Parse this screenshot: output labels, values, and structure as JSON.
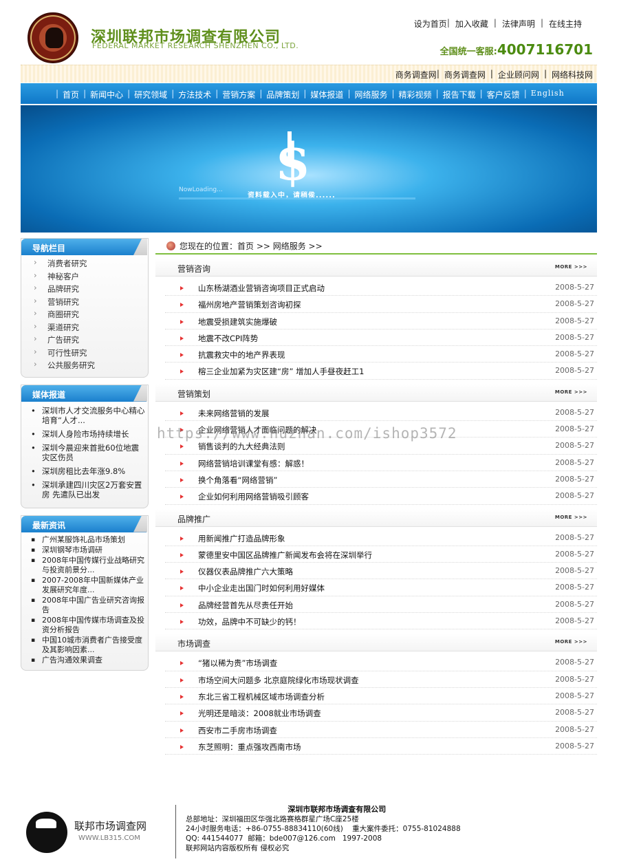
{
  "header": {
    "company_cn": "深圳联邦市场调查有限公司",
    "company_en": "FEDERAL MARKET RESEARCH SHENZHEN CO., LTD.",
    "top_links": [
      "设为首页",
      "加入收藏",
      "法律声明",
      "在线主持"
    ],
    "hotline_label": "全国统一客服:",
    "hotline_number": "4007116701",
    "sub_links": [
      "商务调查网",
      "商务调查网",
      "企业顾问网",
      "网络科技网"
    ]
  },
  "nav": {
    "items": [
      "首页",
      "新闻中心",
      "研究领域",
      "方法技术",
      "营销方案",
      "品牌策划",
      "媒体报道",
      "网络服务",
      "精彩视频",
      "报告下载",
      "客户反馈",
      "English"
    ]
  },
  "banner": {
    "loading_text": "资料载入中，请稍侯......",
    "now_loading": "NowLoading..."
  },
  "sidebar": {
    "nav_title": "导航栏目",
    "nav_items": [
      "消费者研究",
      "神秘客户",
      "品牌研究",
      "营销研究",
      "商圈研究",
      "渠道研究",
      "广告研究",
      "可行性研究",
      "公共服务研究"
    ],
    "media_title": "媒体报道",
    "media_items": [
      "深圳市人才交流服务中心精心培育“人才...",
      "深圳人身险市场持续增长",
      "深圳今晨迎来首批60位地震灾区伤员",
      "深圳房租比去年涨9.8%",
      "深圳承建四川灾区2万套安置房 先遣队已出发"
    ],
    "news_title": "最新资讯",
    "news_items": [
      "广州某服饰礼品市场策划",
      "深圳钢琴市场调研",
      "2008年中国传媒行业战略研究与投资前景分...",
      "2007-2008年中国新媒体产业发展研究年度...",
      "2008年中国广告业研究咨询报告",
      "2008年中国传媒市场调查及投资分析报告",
      "中国10城市消费者广告接受度及其影响因素...",
      "广告沟通效果调查"
    ]
  },
  "main": {
    "breadcrumb": "您现在的位置：首页 >> 网络服务 >>",
    "more_label": "MORE >>>",
    "sections": [
      {
        "title": "营销咨询",
        "rows": [
          {
            "text": "山东杨湖酒业营销咨询项目正式启动",
            "date": "2008-5-27"
          },
          {
            "text": "福州房地产营销策划咨询初探",
            "date": "2008-5-27"
          },
          {
            "text": "地震受损建筑实施爆破",
            "date": "2008-5-27"
          },
          {
            "text": "地震不改CPI阵势",
            "date": "2008-5-27"
          },
          {
            "text": "抗震救灾中的地产界表现",
            "date": "2008-5-27"
          },
          {
            "text": "榕三企业加紧为灾区建“房” 增加人手昼夜赶工1",
            "date": "2008-5-27"
          }
        ]
      },
      {
        "title": "营销策划",
        "rows": [
          {
            "text": "未来网络营销的发展",
            "date": "2008-5-27"
          },
          {
            "text": "企业网络营销人才面临问题的解决",
            "date": "2008-5-27"
          },
          {
            "text": "销售谈判的九大经典法则",
            "date": "2008-5-27"
          },
          {
            "text": "网络营销培训课堂有感：解惑！",
            "date": "2008-5-27"
          },
          {
            "text": "换个角落看“网络营销”",
            "date": "2008-5-27"
          },
          {
            "text": "企业如何利用网络营销吸引顾客",
            "date": "2008-5-27"
          }
        ]
      },
      {
        "title": "品牌推广",
        "rows": [
          {
            "text": "用新闻推广打造品牌形象",
            "date": "2008-5-27"
          },
          {
            "text": "蒙德里安中国区品牌推广新闻发布会将在深圳举行",
            "date": "2008-5-27"
          },
          {
            "text": "仪器仪表品牌推广六大策略",
            "date": "2008-5-27"
          },
          {
            "text": "中小企业走出国门时如何利用好媒体",
            "date": "2008-5-27"
          },
          {
            "text": "品牌经营首先从尽责任开始",
            "date": "2008-5-27"
          },
          {
            "text": "功效，品牌中不可缺少的钙！",
            "date": "2008-5-27"
          }
        ]
      },
      {
        "title": "市场调查",
        "rows": [
          {
            "text": "“猪以稀为贵”市场调查",
            "date": "2008-5-27"
          },
          {
            "text": "市场空间大问题多 北京庭院绿化市场现状调查",
            "date": "2008-5-27"
          },
          {
            "text": "东北三省工程机械区域市场调查分析",
            "date": "2008-5-27"
          },
          {
            "text": "光明还是暗淡：2008就业市场调查",
            "date": "2008-5-27"
          },
          {
            "text": "西安市二手房市场调查",
            "date": "2008-5-27"
          },
          {
            "text": "东芝照明：重点强攻西南市场",
            "date": "2008-5-27"
          }
        ]
      }
    ]
  },
  "watermark": "https://www.huzhan.com/ishop3572",
  "footer": {
    "brand_name": "联邦市场调查网",
    "brand_url": "WWW.LB315.COM",
    "title": "深圳市联邦市场调查有限公司",
    "lines": [
      "总部地址：深圳福田区华强北路赛格群星广场C座25楼",
      "24小时服务电话：+86-0755-88834110(60线)    重大案件委托：0755-81024888",
      "QQ: 441544077  邮箱：bde007@126.com   1997-2008",
      "联邦网站内容版权所有  侵权必究"
    ]
  }
}
